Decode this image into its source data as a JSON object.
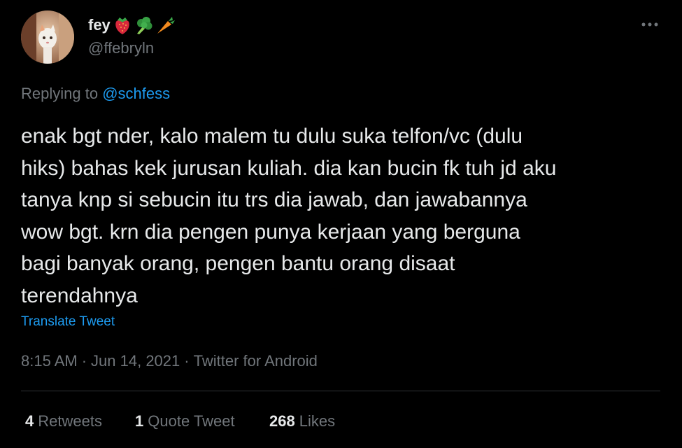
{
  "tweet": {
    "author": {
      "display_name": "fey",
      "name_emojis": [
        "strawberry-icon",
        "broccoli-icon",
        "carrot-icon"
      ],
      "handle": "@ffebryln"
    },
    "more_icon": "more-dots-icon",
    "replying_prefix": "Replying to",
    "replying_mention": "@schfess",
    "text": "enak bgt nder, kalo malem tu dulu suka telfon/vc (dulu\nhiks) bahas kek jurusan kuliah. dia kan bucin fk tuh jd aku\ntanya knp si sebucin itu trs dia jawab, dan jawabannya\nwow bgt. krn dia pengen punya kerjaan yang berguna\nbagi banyak orang, pengen bantu orang disaat\nterendahnya",
    "translate_label": "Translate Tweet",
    "time": "8:15 AM",
    "date": "Jun 14, 2021",
    "source": "Twitter for Android",
    "separator": "·",
    "stats": {
      "retweets_count": "4",
      "retweets_label": "Retweets",
      "quote_count": "1",
      "quote_label": "Quote Tweet",
      "likes_count": "268",
      "likes_label": "Likes"
    }
  },
  "colors": {
    "background": "#000000",
    "primary_text": "#e7e9ea",
    "secondary_text": "#71767b",
    "link": "#1d9bf0",
    "divider": "#2f3336"
  }
}
